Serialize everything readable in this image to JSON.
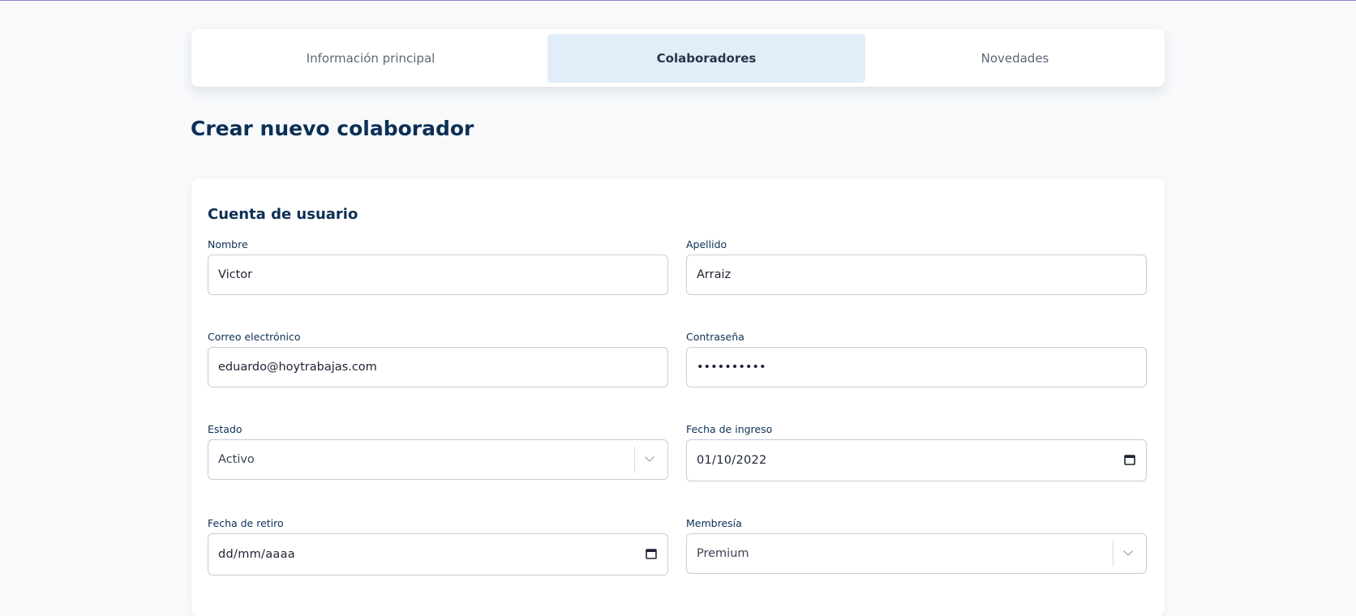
{
  "tabs": [
    {
      "label": "Información principal",
      "active": false
    },
    {
      "label": "Colaboradores",
      "active": true
    },
    {
      "label": "Novedades",
      "active": false
    }
  ],
  "page": {
    "title": "Crear nuevo colaborador"
  },
  "form": {
    "section_title": "Cuenta de usuario",
    "fields": {
      "nombre": {
        "label": "Nombre",
        "value": "Victor"
      },
      "apellido": {
        "label": "Apellido",
        "value": "Arraiz"
      },
      "correo": {
        "label": "Correo electrónico",
        "value": "eduardo@hoytrabajas.com"
      },
      "contrasena": {
        "label": "Contraseña",
        "value": "••••••••••"
      },
      "estado": {
        "label": "Estado",
        "value": "Activo"
      },
      "fecha_ingreso": {
        "label": "Fecha de ingreso",
        "value": "01/10/2022"
      },
      "fecha_retiro": {
        "label": "Fecha de retiro",
        "value": "dd/mm/aaaa"
      },
      "membresia": {
        "label": "Membresía",
        "value": "Premium"
      }
    }
  },
  "icons": {
    "select": "chevron-down-icon",
    "date": "calendar-icon"
  },
  "colors": {
    "primary_text": "#0c2f55",
    "active_tab_bg": "#e1eef9",
    "page_bg": "#f7f9fb",
    "top_accent": "#9b7fc6"
  }
}
